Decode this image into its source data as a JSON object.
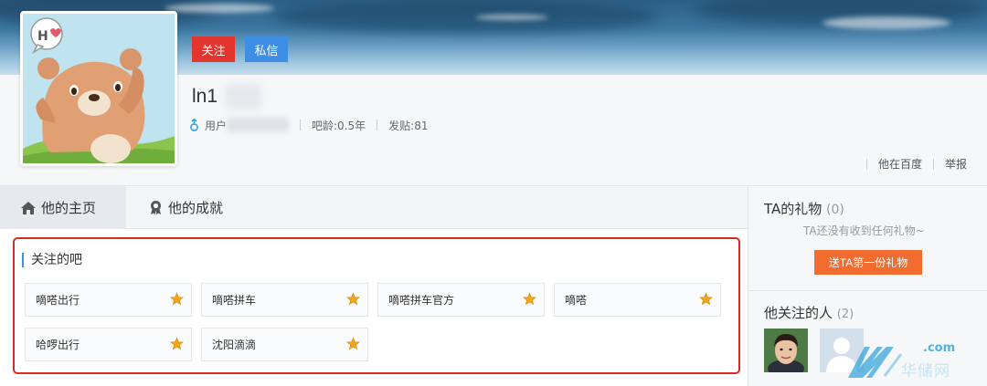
{
  "profile": {
    "follow_button": "关注",
    "message_button": "私信",
    "username": "ln1",
    "user_label": "用户",
    "age_label": "吧龄:0.5年",
    "posts_label": "发贴:81",
    "avatar_badge": "Hi"
  },
  "top_links": {
    "baidu": "他在百度",
    "report": "举报"
  },
  "tabs": [
    {
      "label": "他的主页"
    },
    {
      "label": "他的成就"
    }
  ],
  "follow_section": {
    "title": "关注的吧",
    "items": [
      {
        "label": "嘀嗒出行"
      },
      {
        "label": "嘀嗒拼车"
      },
      {
        "label": "嘀嗒拼车官方"
      },
      {
        "label": "嘀嗒"
      },
      {
        "label": "哈啰出行"
      },
      {
        "label": "沈阳滴滴"
      }
    ]
  },
  "gifts": {
    "title": "TA的礼物",
    "count": "(0)",
    "empty_note": "TA还没有收到任何礼物~",
    "send_button": "送TA第一份礼物"
  },
  "following": {
    "title": "他关注的人",
    "count": "(2)"
  },
  "watermark": {
    "domain": ".com",
    "text": "华储网"
  },
  "colors": {
    "follow_red": "#e2352e",
    "message_blue": "#3e8ee6",
    "gift_orange": "#f36c2f",
    "highlight_red": "#d62a22",
    "star_gold": "#f0a51c"
  }
}
